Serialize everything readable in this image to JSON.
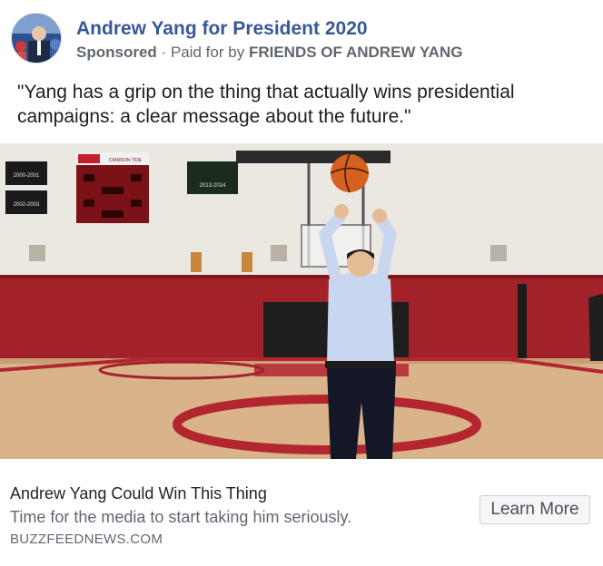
{
  "header": {
    "page_name": "Andrew Yang for President 2020",
    "sponsored_label": "Sponsored",
    "separator": "·",
    "paid_for_prefix": "Paid for by",
    "paid_for_org": "FRIENDS OF ANDREW YANG"
  },
  "post": {
    "text": "\"Yang has a grip on the thing that actually wins presidential campaigns: a clear message about the future.\""
  },
  "image": {
    "banners": {
      "left_top": "2000-2001",
      "left_bottom": "2002-2003",
      "scoreboard_top": "CRIMSON TIDE",
      "right_banner": "2013-2014"
    }
  },
  "link_card": {
    "title": "Andrew Yang Could Win This Thing",
    "description": "Time for the media to start taking him seriously.",
    "domain": "BUZZFEEDNEWS.COM",
    "cta_label": "Learn More"
  },
  "colors": {
    "brand_blue": "#385898",
    "gym_red": "#a3222a",
    "court_wood": "#d9b48a"
  }
}
